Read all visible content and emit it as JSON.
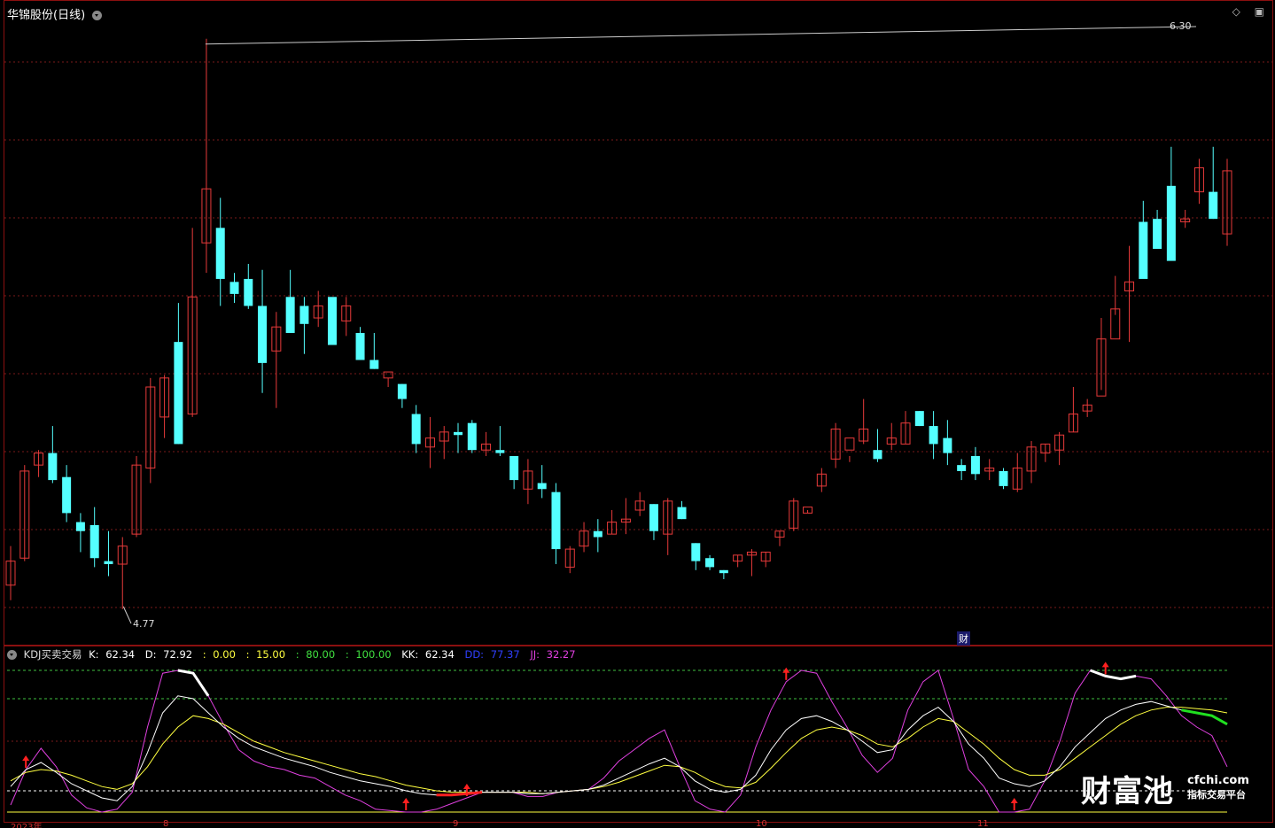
{
  "window": {
    "title": "华锦股份(日线)",
    "icons": [
      "diamond-icon",
      "box-icon"
    ]
  },
  "colors": {
    "up": "#e83a3a",
    "down": "#54ffff",
    "grid": "#7a1a1a",
    "k": "#ffffff",
    "d": "#ffff40",
    "j": "#e040e0",
    "dd": "#3040ff",
    "kk": "#ffffff",
    "signal_buy": "#ff2020",
    "signal_sell": "#20e020"
  },
  "price_chart": {
    "max_label": "6.30",
    "min_label": "4.77",
    "badge": "财",
    "candles": [
      [
        4.86,
        4.94,
        4.99,
        4.81
      ],
      [
        4.95,
        5.24,
        5.26,
        4.94
      ],
      [
        5.26,
        5.3,
        5.31,
        5.22
      ],
      [
        5.3,
        5.21,
        5.39,
        5.2
      ],
      [
        5.22,
        5.1,
        5.26,
        5.07
      ],
      [
        5.07,
        5.04,
        5.1,
        4.97
      ],
      [
        5.06,
        4.95,
        5.12,
        4.92
      ],
      [
        4.94,
        4.93,
        5.04,
        4.89
      ],
      [
        4.93,
        4.99,
        5.02,
        4.78
      ],
      [
        5.03,
        5.26,
        5.29,
        5.02
      ],
      [
        5.25,
        5.52,
        5.55,
        5.2
      ],
      [
        5.42,
        5.55,
        5.56,
        5.35
      ],
      [
        5.67,
        5.33,
        5.8,
        5.33
      ],
      [
        5.43,
        5.82,
        6.05,
        5.42
      ],
      [
        6.0,
        6.18,
        6.68,
        5.9
      ],
      [
        6.05,
        5.88,
        6.15,
        5.79
      ],
      [
        5.87,
        5.83,
        5.9,
        5.8
      ],
      [
        5.88,
        5.79,
        5.93,
        5.78
      ],
      [
        5.79,
        5.6,
        5.91,
        5.5
      ],
      [
        5.64,
        5.72,
        5.77,
        5.45
      ],
      [
        5.82,
        5.7,
        5.91,
        5.7
      ],
      [
        5.79,
        5.73,
        5.82,
        5.63
      ],
      [
        5.75,
        5.79,
        5.84,
        5.72
      ],
      [
        5.82,
        5.66,
        5.81,
        5.73
      ],
      [
        5.74,
        5.79,
        5.82,
        5.69
      ],
      [
        5.7,
        5.61,
        5.72,
        5.61
      ],
      [
        5.61,
        5.58,
        5.7,
        5.58
      ],
      [
        5.55,
        5.57,
        5.55,
        5.52
      ],
      [
        5.53,
        5.48,
        5.53,
        5.45
      ],
      [
        5.43,
        5.33,
        5.46,
        5.3
      ],
      [
        5.32,
        5.35,
        5.42,
        5.25
      ],
      [
        5.34,
        5.37,
        5.39,
        5.28
      ],
      [
        5.37,
        5.36,
        5.4,
        5.3
      ],
      [
        5.4,
        5.31,
        5.41,
        5.3
      ],
      [
        5.31,
        5.33,
        5.37,
        5.29
      ],
      [
        5.31,
        5.3,
        5.39,
        5.29
      ],
      [
        5.29,
        5.21,
        5.29,
        5.18
      ],
      [
        5.18,
        5.24,
        5.28,
        5.13
      ],
      [
        5.2,
        5.18,
        5.26,
        5.15
      ],
      [
        5.17,
        4.98,
        5.2,
        4.93
      ],
      [
        4.92,
        4.98,
        4.99,
        4.9
      ],
      [
        4.99,
        5.04,
        5.07,
        4.97
      ],
      [
        5.04,
        5.02,
        5.08,
        4.97
      ],
      [
        5.03,
        5.07,
        5.11,
        5.03
      ],
      [
        5.07,
        5.08,
        5.15,
        5.03
      ],
      [
        5.11,
        5.14,
        5.17,
        5.09
      ],
      [
        5.13,
        5.04,
        5.13,
        5.01
      ],
      [
        5.03,
        5.14,
        5.15,
        4.96
      ],
      [
        5.12,
        5.08,
        5.14,
        5.08
      ],
      [
        5.0,
        4.94,
        5.0,
        4.91
      ],
      [
        4.95,
        4.92,
        4.96,
        4.91
      ],
      [
        4.91,
        4.9,
        4.91,
        4.88
      ],
      [
        4.94,
        4.96,
        4.96,
        4.92
      ],
      [
        4.96,
        4.97,
        4.98,
        4.89
      ],
      [
        4.94,
        4.97,
        4.97,
        4.92
      ],
      [
        5.02,
        5.04,
        5.04,
        4.99
      ],
      [
        5.05,
        5.14,
        5.15,
        5.04
      ],
      [
        5.1,
        5.12,
        5.11,
        5.1
      ],
      [
        5.19,
        5.23,
        5.25,
        5.17
      ],
      [
        5.28,
        5.38,
        5.4,
        5.25
      ],
      [
        5.31,
        5.35,
        5.29,
        5.27
      ],
      [
        5.34,
        5.38,
        5.48,
        5.33
      ],
      [
        5.31,
        5.28,
        5.38,
        5.27
      ],
      [
        5.33,
        5.35,
        5.4,
        5.31
      ],
      [
        5.33,
        5.4,
        5.44,
        5.33
      ],
      [
        5.44,
        5.39,
        5.44,
        5.39
      ],
      [
        5.39,
        5.33,
        5.44,
        5.28
      ],
      [
        5.35,
        5.3,
        5.41,
        5.26
      ],
      [
        5.26,
        5.24,
        5.28,
        5.21
      ],
      [
        5.29,
        5.23,
        5.32,
        5.21
      ],
      [
        5.24,
        5.25,
        5.28,
        5.21
      ],
      [
        5.24,
        5.19,
        5.25,
        5.18
      ],
      [
        5.18,
        5.25,
        5.3,
        5.17
      ],
      [
        5.24,
        5.32,
        5.34,
        5.2
      ],
      [
        5.3,
        5.33,
        5.33,
        5.27
      ],
      [
        5.31,
        5.36,
        5.37,
        5.26
      ],
      [
        5.37,
        5.43,
        5.52,
        5.37
      ],
      [
        5.44,
        5.46,
        5.48,
        5.42
      ],
      [
        5.49,
        5.68,
        5.75,
        5.51
      ],
      [
        5.68,
        5.78,
        5.89,
        5.76
      ],
      [
        5.84,
        5.87,
        5.99,
        5.67
      ],
      [
        6.07,
        5.88,
        6.14,
        5.89
      ],
      [
        6.08,
        5.98,
        6.11,
        5.98
      ],
      [
        6.19,
        5.94,
        6.32,
        5.95
      ],
      [
        6.07,
        6.08,
        6.11,
        6.05
      ],
      [
        6.17,
        6.25,
        6.28,
        6.13
      ],
      [
        6.17,
        6.08,
        6.32,
        6.08
      ],
      [
        6.03,
        6.24,
        6.28,
        5.99
      ]
    ]
  },
  "indicator": {
    "name": "KDJ买卖交易",
    "k_label": "K:",
    "k_value": "62.34",
    "d_label": "D:",
    "d_value": "72.92",
    "levels": [
      ":",
      "0.00",
      ":",
      "15.00",
      ":",
      "80.00",
      ":",
      "100.00"
    ],
    "kk_label": "KK:",
    "kk_value": "62.34",
    "dd_label": "DD:",
    "dd_value": "77.37",
    "jj_label": "JJ:",
    "jj_value": "32.27",
    "K": [
      18,
      30,
      35,
      28,
      20,
      15,
      10,
      8,
      18,
      42,
      70,
      82,
      80,
      70,
      60,
      52,
      46,
      42,
      38,
      35,
      32,
      28,
      25,
      22,
      20,
      18,
      15,
      13,
      12,
      12,
      13,
      14,
      14,
      14,
      13,
      13,
      14,
      15,
      16,
      19,
      24,
      29,
      34,
      38,
      32,
      22,
      16,
      14,
      16,
      26,
      44,
      58,
      66,
      68,
      64,
      58,
      50,
      42,
      44,
      58,
      68,
      74,
      64,
      48,
      38,
      24,
      20,
      18,
      22,
      32,
      46,
      56,
      66,
      72,
      76,
      78,
      75,
      72,
      70,
      68,
      62
    ],
    "D": [
      22,
      28,
      30,
      29,
      26,
      22,
      18,
      16,
      20,
      32,
      48,
      60,
      68,
      66,
      62,
      56,
      50,
      46,
      42,
      39,
      36,
      33,
      30,
      27,
      25,
      22,
      19,
      17,
      15,
      14,
      14,
      14,
      14,
      14,
      14,
      13,
      14,
      15,
      16,
      18,
      21,
      25,
      29,
      33,
      32,
      28,
      22,
      18,
      17,
      21,
      31,
      42,
      52,
      58,
      60,
      58,
      54,
      48,
      46,
      52,
      60,
      66,
      64,
      56,
      48,
      38,
      30,
      26,
      26,
      30,
      38,
      46,
      54,
      62,
      68,
      72,
      74,
      74,
      73,
      72,
      70
    ],
    "J": [
      5,
      30,
      45,
      32,
      12,
      3,
      0,
      2,
      14,
      60,
      98,
      100,
      98,
      82,
      62,
      44,
      36,
      32,
      30,
      26,
      24,
      18,
      12,
      8,
      2,
      1,
      0,
      0,
      2,
      6,
      10,
      14,
      14,
      14,
      11,
      11,
      14,
      15,
      16,
      24,
      36,
      44,
      52,
      58,
      32,
      8,
      2,
      0,
      12,
      46,
      72,
      92,
      100,
      98,
      78,
      60,
      40,
      28,
      38,
      72,
      92,
      100,
      66,
      30,
      18,
      0,
      0,
      2,
      22,
      50,
      84,
      100,
      96,
      94,
      96,
      94,
      82,
      68,
      60,
      54,
      32
    ],
    "buy_signals": [
      1,
      26,
      30,
      51,
      66,
      72
    ],
    "sell_signals": [
      82
    ]
  },
  "x_axis": {
    "labels": [
      "2023年",
      "8",
      "9",
      "10",
      "11"
    ]
  },
  "watermark": {
    "name": "财富池",
    "domain": "cfchi.com",
    "slogan": "指标交易平台"
  }
}
